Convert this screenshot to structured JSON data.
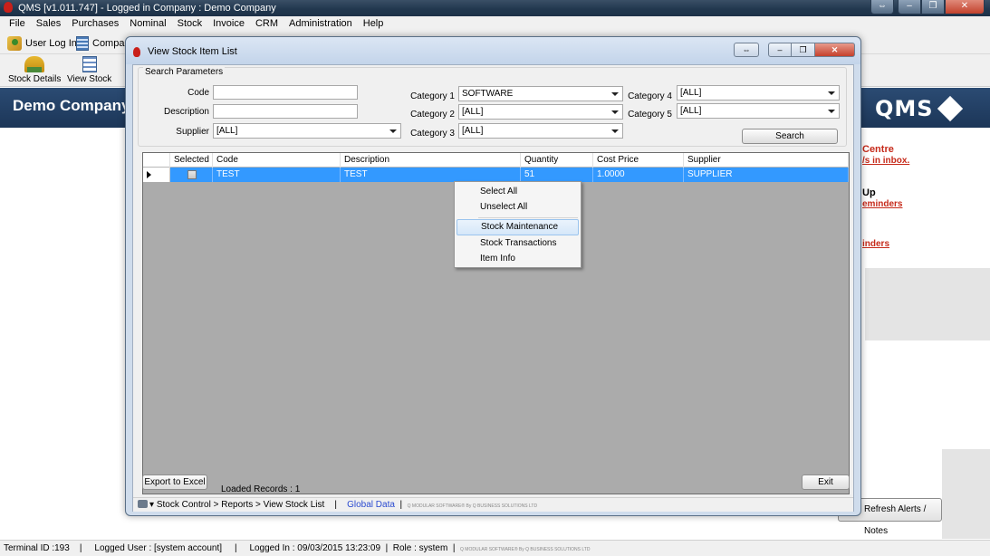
{
  "app": {
    "title": "QMS  [v1.011.747]  -  Logged in Company : Demo Company",
    "company_name": "Demo Company",
    "logo_text": "QMS"
  },
  "menubar": [
    "File",
    "Sales",
    "Purchases",
    "Nominal",
    "Stock",
    "Invoice",
    "CRM",
    "Administration",
    "Help"
  ],
  "toolbar": {
    "user_log_in": "User Log In",
    "company": "Company",
    "stock_details": "Stock Details",
    "view_stock": "View Stock"
  },
  "side_panel": {
    "centre_title": "Centre",
    "inbox_link": "/s in inbox.",
    "follow_up_title": "Up",
    "reminders_link_1": "eminders",
    "reminders_link_2": "inders",
    "refresh_button": "Refresh Alerts / Notes"
  },
  "dialog": {
    "title": "View Stock Item List",
    "search_group_label": "Search Parameters",
    "fields": {
      "code_label": "Code",
      "code_value": "",
      "description_label": "Description",
      "description_value": "",
      "supplier_label": "Supplier",
      "supplier_value": "[ALL]",
      "category1_label": "Category 1",
      "category1_value": "SOFTWARE",
      "category2_label": "Category 2",
      "category2_value": "[ALL]",
      "category3_label": "Category 3",
      "category3_value": "[ALL]",
      "category4_label": "Category 4",
      "category4_value": "[ALL]",
      "category5_label": "Category 5",
      "category5_value": "[ALL]"
    },
    "search_button": "Search",
    "grid": {
      "columns": [
        "Selected",
        "Code",
        "Description",
        "Quantity",
        "Cost Price",
        "Supplier"
      ],
      "rows": [
        {
          "selected": false,
          "code": "TEST",
          "description": "TEST",
          "quantity": "51",
          "cost_price": "1.0000",
          "supplier": "SUPPLIER"
        }
      ]
    },
    "export_button": "Export to Excel",
    "loaded_records": "Loaded Records : 1",
    "exit_button": "Exit",
    "breadcrumb": "Stock Control > Reports > View Stock List",
    "global_data": "Global Data",
    "brand_small": "Q MODULAR SOFTWARE® By Q BUSINESS SOLUTIONS LTD"
  },
  "context_menu": {
    "items": [
      "Select All",
      "Unselect All",
      "Stock Maintenance",
      "Stock Transactions",
      "Item Info"
    ],
    "highlighted": "Stock Maintenance"
  },
  "statusbar": {
    "terminal": "Terminal ID :193",
    "user": "Logged User : [system account]",
    "logged_in": "Logged In : 09/03/2015 13:23:09",
    "role": "Role : system",
    "brand_small": "Q MODULAR SOFTWARE® By Q BUSINESS SOLUTIONS LTD"
  },
  "colors": {
    "banner": "#1c3658",
    "selection": "#3399ff",
    "alert_red": "#c62a1a"
  }
}
